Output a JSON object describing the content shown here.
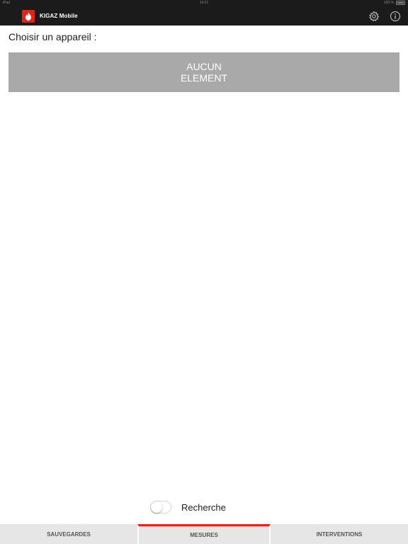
{
  "status_bar": {
    "carrier": "iPad",
    "time": "14:21",
    "battery": "100 %"
  },
  "header": {
    "app_title": "KIGAZ Mobile"
  },
  "main": {
    "choose_label": "Choisir un appareil :",
    "empty_line1": "AUCUN",
    "empty_line2": "ELEMENT"
  },
  "search": {
    "label": "Recherche",
    "enabled": false
  },
  "tabs": [
    {
      "label": "SAUVEGARDES",
      "active": false
    },
    {
      "label": "MESURES",
      "active": true
    },
    {
      "label": "INTERVENTIONS",
      "active": false
    }
  ],
  "colors": {
    "accent": "#e2231a",
    "topbar": "#1b1b1b",
    "empty_box": "#a9a9a9",
    "tabbar": "#e6e6e6"
  }
}
